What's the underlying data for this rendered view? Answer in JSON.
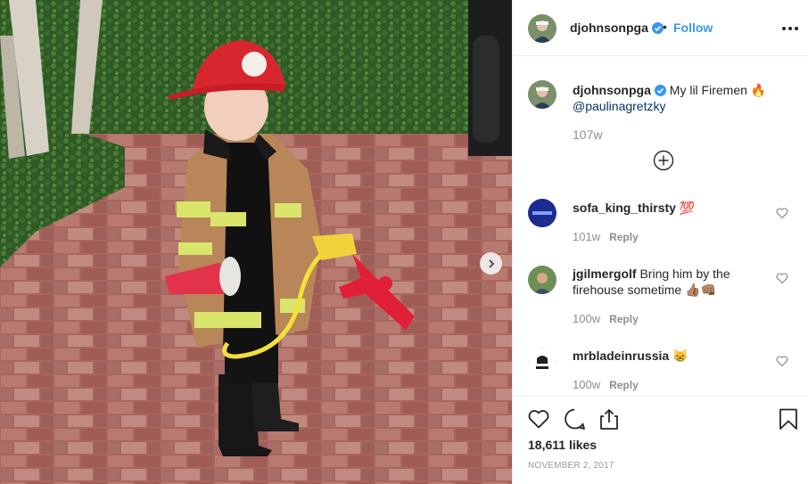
{
  "post": {
    "author": "djohnsonpga",
    "follow_label": "Follow",
    "dot": "•",
    "caption_text": "My lil Firemen",
    "caption_emoji": "🔥",
    "caption_mention": "@paulinagretzky",
    "caption_time": "107w",
    "likes": "18,611 likes",
    "date": "NOVEMBER 2, 2017"
  },
  "comments": [
    {
      "user": "sofa_king_thirsty",
      "text": "",
      "emoji": "💯",
      "time": "101w",
      "reply": "Reply"
    },
    {
      "user": "jgilmergolf",
      "text": "Bring him by the firehouse sometime",
      "emoji": "👍🏽👊🏽",
      "time": "100w",
      "reply": "Reply"
    },
    {
      "user": "mrbladeinrussia",
      "text": "",
      "emoji": "😸",
      "time": "100w",
      "reply": "Reply"
    }
  ],
  "colors": {
    "link": "#3897f0",
    "mention": "#003569",
    "muted": "#8e8e8e"
  },
  "icons": [
    "verified-badge-icon",
    "more-options-icon",
    "load-more-icon",
    "heart-icon",
    "comment-icon",
    "share-icon",
    "bookmark-icon",
    "next-arrow-icon"
  ]
}
